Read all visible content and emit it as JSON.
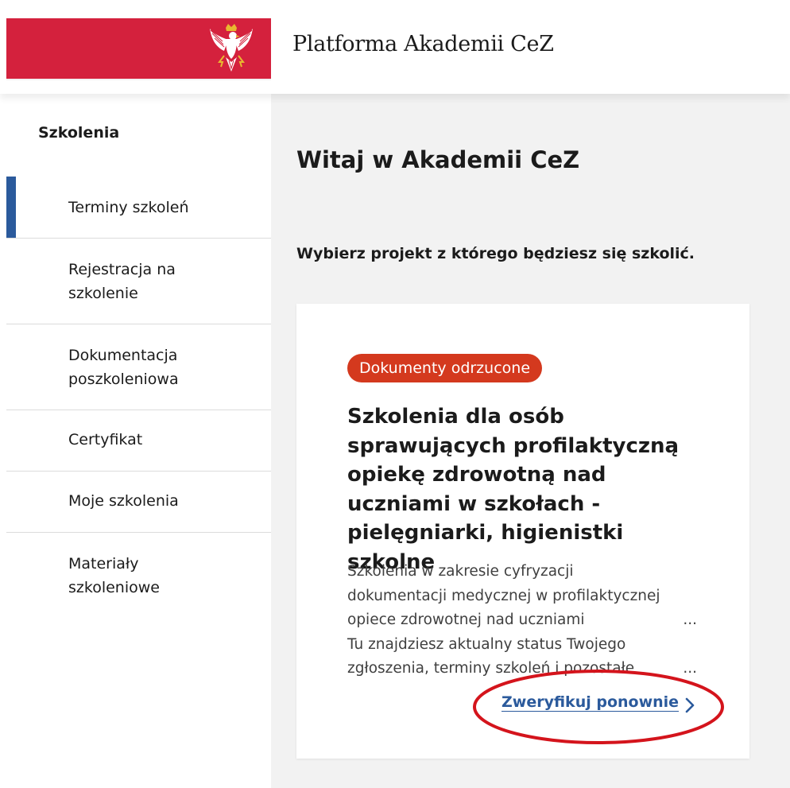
{
  "header": {
    "site_title": "Platforma Akademii CeZ",
    "emblem_icon": "polish-eagle-icon",
    "flag_color": "#d4213d"
  },
  "sidebar": {
    "heading": "Szkolenia",
    "items": [
      {
        "label": "Terminy szkoleń",
        "active": true
      },
      {
        "label": "Rejestracja na szkolenie",
        "active": false
      },
      {
        "label": "Dokumentacja poszkoleniowa",
        "active": false
      },
      {
        "label": "Certyfikat",
        "active": false
      },
      {
        "label": "Moje szkolenia",
        "active": false
      },
      {
        "label": "Materiały szkoleniowe",
        "active": false
      }
    ],
    "active_color": "#2b5a9c"
  },
  "main": {
    "title": "Witaj w Akademii CeZ",
    "subtitle": "Wybierz projekt z którego będziesz się szkolić.",
    "card": {
      "badge": "Dokumenty odrzucone",
      "badge_color": "#d4391e",
      "title": "Szkolenia dla osób sprawujących profilaktyczną opiekę zdrowotną nad uczniami w szkołach - pielęgniarki, higienistki szkolne",
      "description_lines": [
        "Szkolenia w zakresie cyfryzacji",
        "dokumentacji medycznej w profilaktycznej",
        "opiece zdrowotnej nad uczniami",
        "Tu znajdziesz aktualny status Twojego",
        "zgłoszenia, terminy szkoleń i pozostałe"
      ],
      "ellipsis": "...",
      "link_label": "Zweryfikuj ponownie",
      "link_icon": "chevron-right-icon",
      "highlight_color": "#d4141c"
    }
  }
}
